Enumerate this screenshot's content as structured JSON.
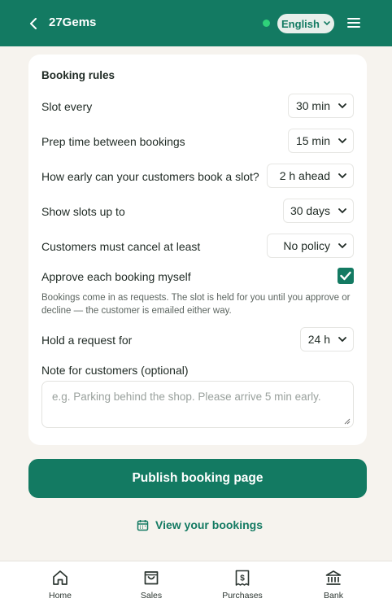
{
  "header": {
    "brand": "27Gems",
    "language": "English",
    "icons": [
      "back-chevron-icon",
      "status-dot",
      "chevron-down-icon",
      "hamburger-menu-icon"
    ]
  },
  "booking_rules": {
    "title": "Booking rules",
    "rows": [
      {
        "label": "Slot every",
        "value": "30 min"
      },
      {
        "label": "Prep time between bookings",
        "value": "15 min"
      },
      {
        "label": "How early can your customers book a slot?",
        "value": "2 h ahead"
      },
      {
        "label": "Show slots up to",
        "value": "30 days"
      },
      {
        "label": "Customers must cancel at least",
        "value": "No policy"
      }
    ],
    "approve_label": "Approve each booking myself",
    "approve_checked": true,
    "help_text": "Bookings come in as requests. The slot is held for you until you approve or decline — the customer is emailed either way.",
    "hold_label": "Hold a request for",
    "hold_value": "24 h",
    "note_label": "Note for customers (optional)",
    "note_placeholder": "e.g. Parking behind the shop. Please arrive 5 min early."
  },
  "actions": {
    "publish_label": "Publish booking page",
    "view_label": "View your bookings"
  },
  "tabs": [
    {
      "label": "Home",
      "icon": "home-icon"
    },
    {
      "label": "Sales",
      "icon": "shopping-bag-icon"
    },
    {
      "label": "Purchases",
      "icon": "receipt-dollar-icon"
    },
    {
      "label": "Bank",
      "icon": "bank-icon"
    }
  ],
  "colors": {
    "brand": "#137a62",
    "background": "#f6f3ee",
    "status": "#2fd27a"
  }
}
